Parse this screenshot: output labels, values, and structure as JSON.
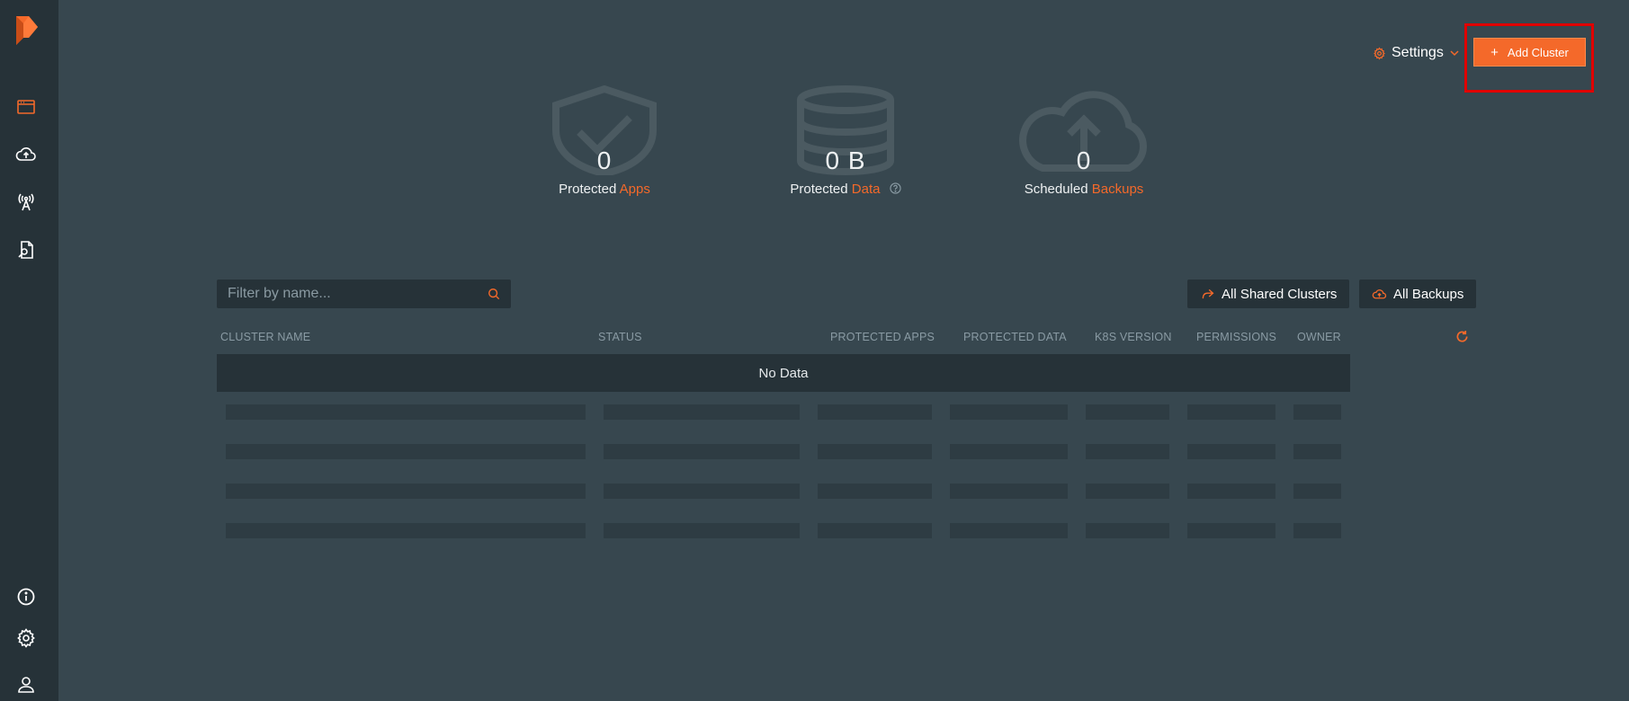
{
  "sidebar": {
    "items": [
      {
        "name": "applications-icon"
      },
      {
        "name": "cloud-upload-icon"
      },
      {
        "name": "antenna-icon"
      },
      {
        "name": "documents-icon"
      }
    ],
    "bottom": [
      {
        "name": "info-icon"
      },
      {
        "name": "gear-icon"
      },
      {
        "name": "user-icon"
      }
    ],
    "accent": "#f4692a"
  },
  "header": {
    "settings_label": "Settings",
    "add_cluster_label": "Add Cluster"
  },
  "stats": [
    {
      "value": "0",
      "label_prefix": "Protected",
      "label_accent": "Apps"
    },
    {
      "value": "0 B",
      "label_prefix": "Protected",
      "label_accent": "Data"
    },
    {
      "value": "0",
      "label_prefix": "Scheduled",
      "label_accent": "Backups"
    }
  ],
  "toolbar": {
    "filter_placeholder": "Filter by name...",
    "shared_clusters_label": "All Shared Clusters",
    "all_backups_label": "All Backups"
  },
  "table": {
    "columns": [
      "CLUSTER NAME",
      "STATUS",
      "PROTECTED APPS",
      "PROTECTED DATA",
      "K8S VERSION",
      "PERMISSIONS",
      "OWNER"
    ],
    "empty_text": "No Data"
  }
}
